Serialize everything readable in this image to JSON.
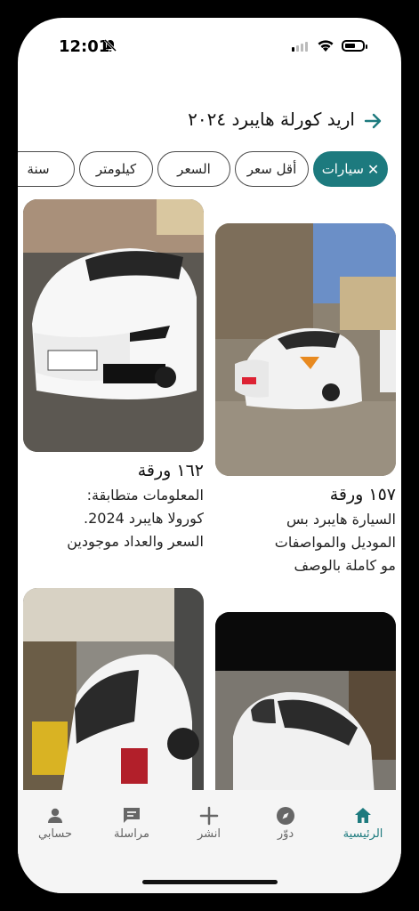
{
  "status_bar": {
    "time": "12:01"
  },
  "search": {
    "query": "اريد كورلة هايبرد ٢٠٢٤"
  },
  "filters": [
    {
      "label": "سيارات",
      "active": true
    },
    {
      "label": "أقل سعر",
      "active": false
    },
    {
      "label": "السعر",
      "active": false
    },
    {
      "label": "كيلومتر",
      "active": false
    },
    {
      "label": "سنة",
      "active": false
    }
  ],
  "listings": [
    {
      "title": "١٥٧ ورقة",
      "desc": [
        "السيارة هايبرد بس",
        "الموديل والمواصفات",
        "مو كاملة بالوصف"
      ]
    },
    {
      "title": "١٦٢ ورقة",
      "desc": [
        "المعلومات متطابقة:",
        "كورولا هايبرد 2024.",
        "السعر والعداد موجودين"
      ]
    },
    {
      "title": "",
      "desc": []
    },
    {
      "title": "",
      "desc": []
    }
  ],
  "tabbar": {
    "home": "الرئيسية",
    "explore": "دوّر",
    "post": "انشر",
    "messages": "مراسلة",
    "account": "حسابي"
  },
  "colors": {
    "accent": "#1d7a7e"
  }
}
